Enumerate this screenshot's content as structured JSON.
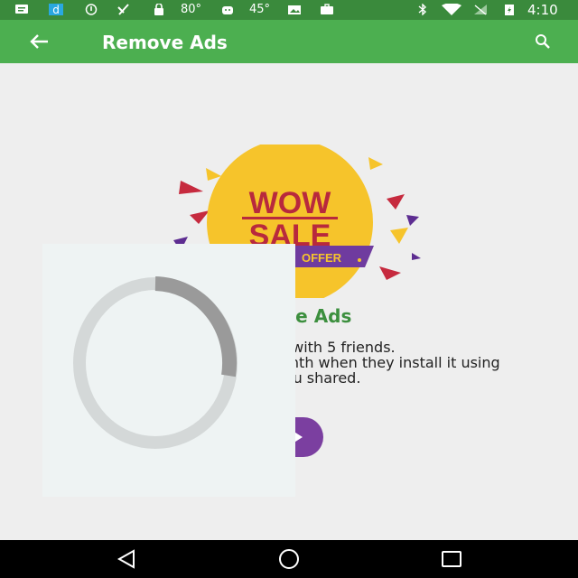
{
  "status_bar": {
    "temp1": "80°",
    "temp2": "45°",
    "time": "4:10"
  },
  "app_bar": {
    "title": "Remove Ads",
    "back_icon": "arrow-back-icon",
    "search_icon": "search-icon"
  },
  "banner": {
    "line1": "WOW",
    "line2": "SALE",
    "tag": "OFFER"
  },
  "content": {
    "headline": "Remove Ads",
    "body_line1": "Share this app with 5 friends.",
    "body_line2": "Ads will be removed for 1 month when they install it using",
    "body_line3": "the link you shared."
  },
  "colors": {
    "app_bar": "#4caf50",
    "status_bar": "#3a8a3c",
    "headline": "#3c8f3e",
    "button": "#7b3fa0",
    "sale_circle": "#f6c42b",
    "sale_text": "#b8293d"
  }
}
